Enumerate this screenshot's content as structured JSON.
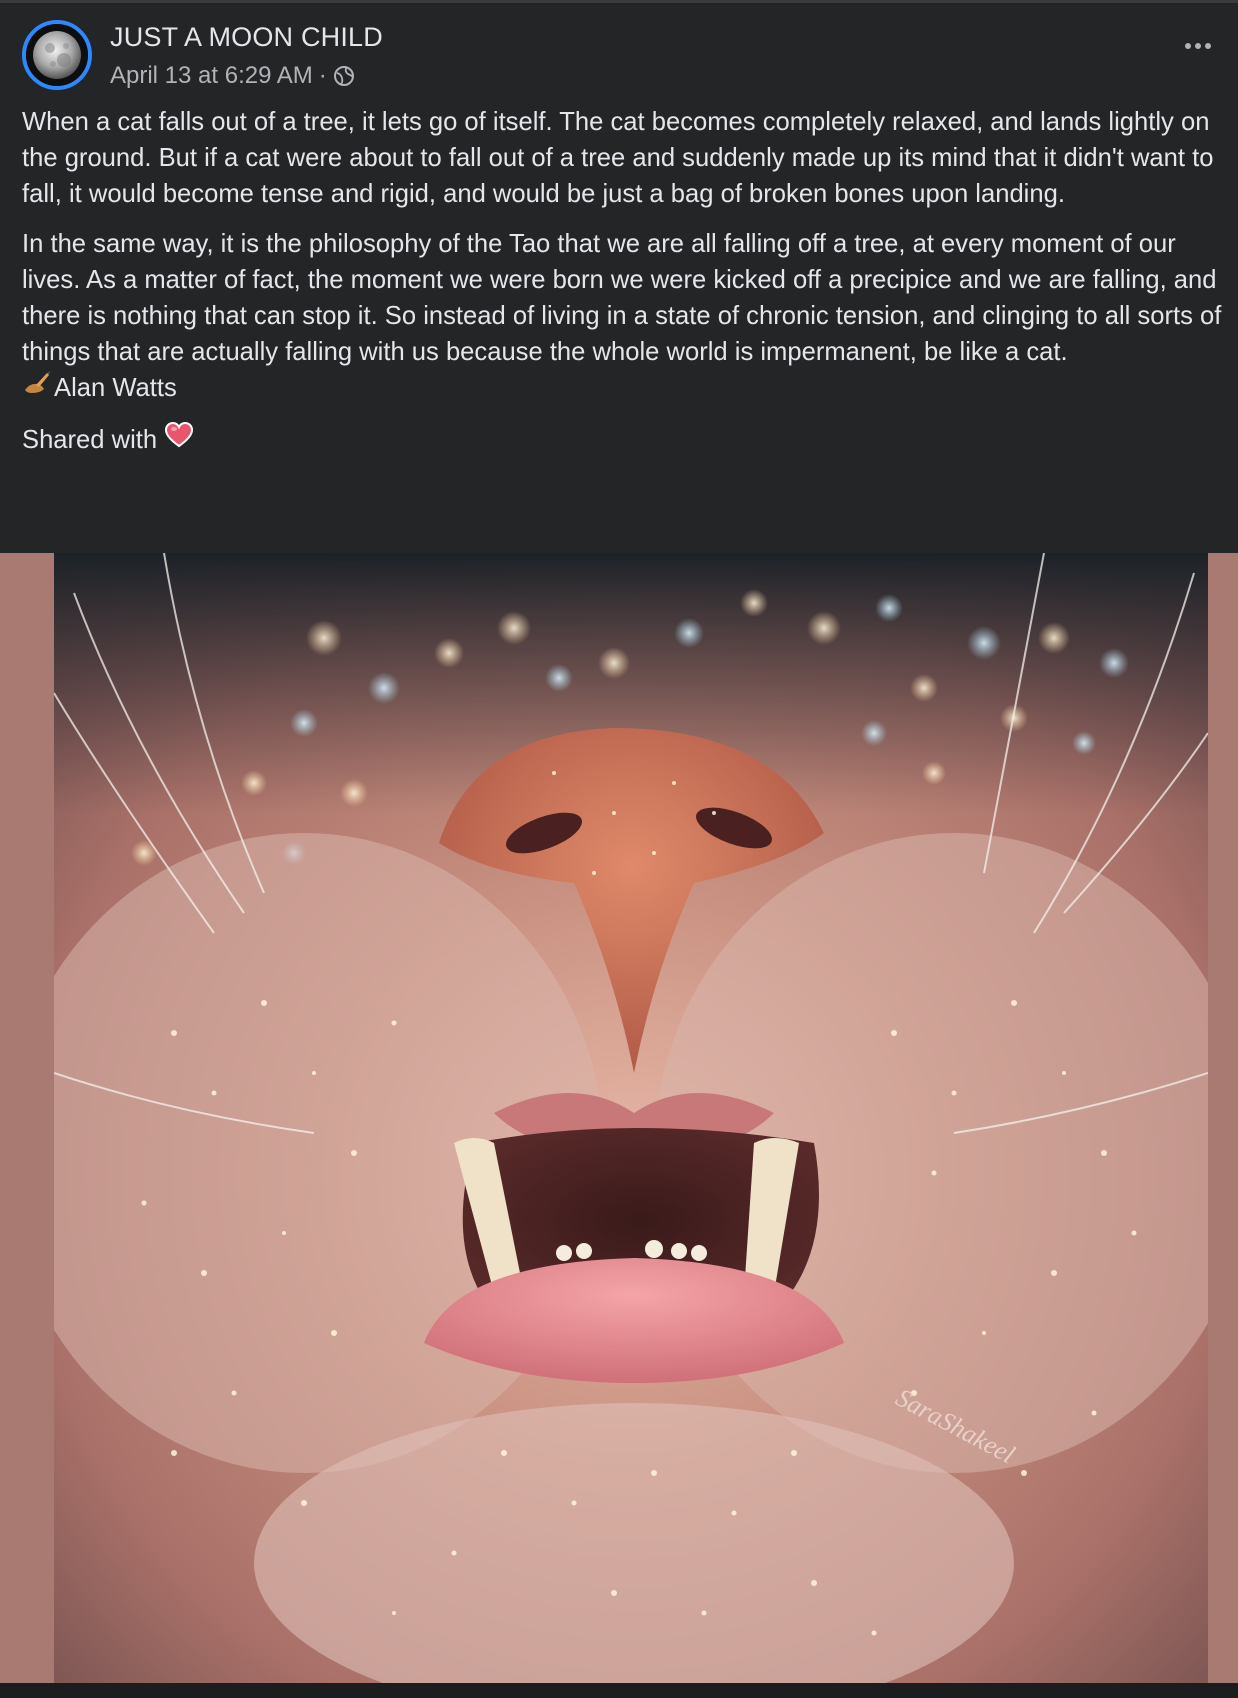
{
  "post": {
    "author": "JUST A MOON CHILD",
    "timestamp": "April 13 at 6:29 AM",
    "separator": "·",
    "privacy_icon": "globe-icon",
    "paragraph1": "When a cat falls out of a tree, it lets go of itself. The cat becomes completely relaxed, and lands lightly on the ground. But if a cat were about to fall out of a tree and suddenly made up its mind that it didn't want to fall, it would become tense and rigid, and would be just a bag of broken bones upon landing.",
    "paragraph2": "In the same way, it is the philosophy of the Tao that we are all falling off a tree, at every moment of our lives. As a matter of fact, the moment we were born we were kicked off a precipice and we are falling, and there is nothing that can stop it. So instead of living in a state of chronic tension, and clinging to all sorts of things that are actually falling with us because the whole world is impermanent, be like a cat.",
    "signature": "Alan Watts",
    "signature_icon": "writing-hand-icon",
    "shared_label": "Shared with",
    "shared_icon": "heart-icon",
    "image_watermark": "SaraShakeel"
  },
  "colors": {
    "background": "#242526",
    "text": "#e4e6eb",
    "secondary_text": "#b0b3b8",
    "avatar_ring": "#2d88ff",
    "photo_border": "#a87a72"
  }
}
